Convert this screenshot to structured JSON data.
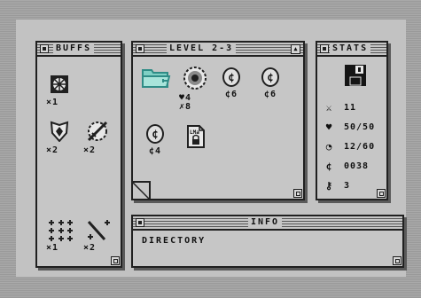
{
  "buffs": {
    "title": "BUFFS",
    "items": [
      {
        "icon": "wheel-icon",
        "count": "×1"
      },
      {
        "icon": "shield-icon",
        "count": "×2"
      },
      {
        "icon": "sword-shield-icon",
        "count": "×2"
      },
      {
        "icon": "sparkles-icon",
        "count": "×1"
      },
      {
        "icon": "wand-icon",
        "count": "×2"
      }
    ]
  },
  "level": {
    "title": "LEVEL 2-3",
    "items": [
      {
        "icon": "folder-icon",
        "label": ""
      },
      {
        "icon": "orb-icon",
        "label1": "♥4",
        "label2": "✗8"
      },
      {
        "icon": "coin-icon",
        "label": "¢6"
      },
      {
        "icon": "coin-icon",
        "label": "¢6"
      },
      {
        "icon": "coin-icon",
        "label": "¢4"
      },
      {
        "icon": "locked-file-icon",
        "file_label": "LMa"
      }
    ]
  },
  "stats": {
    "title": "STATS",
    "attack": "11",
    "health": "50/50",
    "time": "12/60",
    "coins": "0038",
    "keys": "3"
  },
  "info": {
    "title": "INFO",
    "text": "DIRECTORY"
  }
}
